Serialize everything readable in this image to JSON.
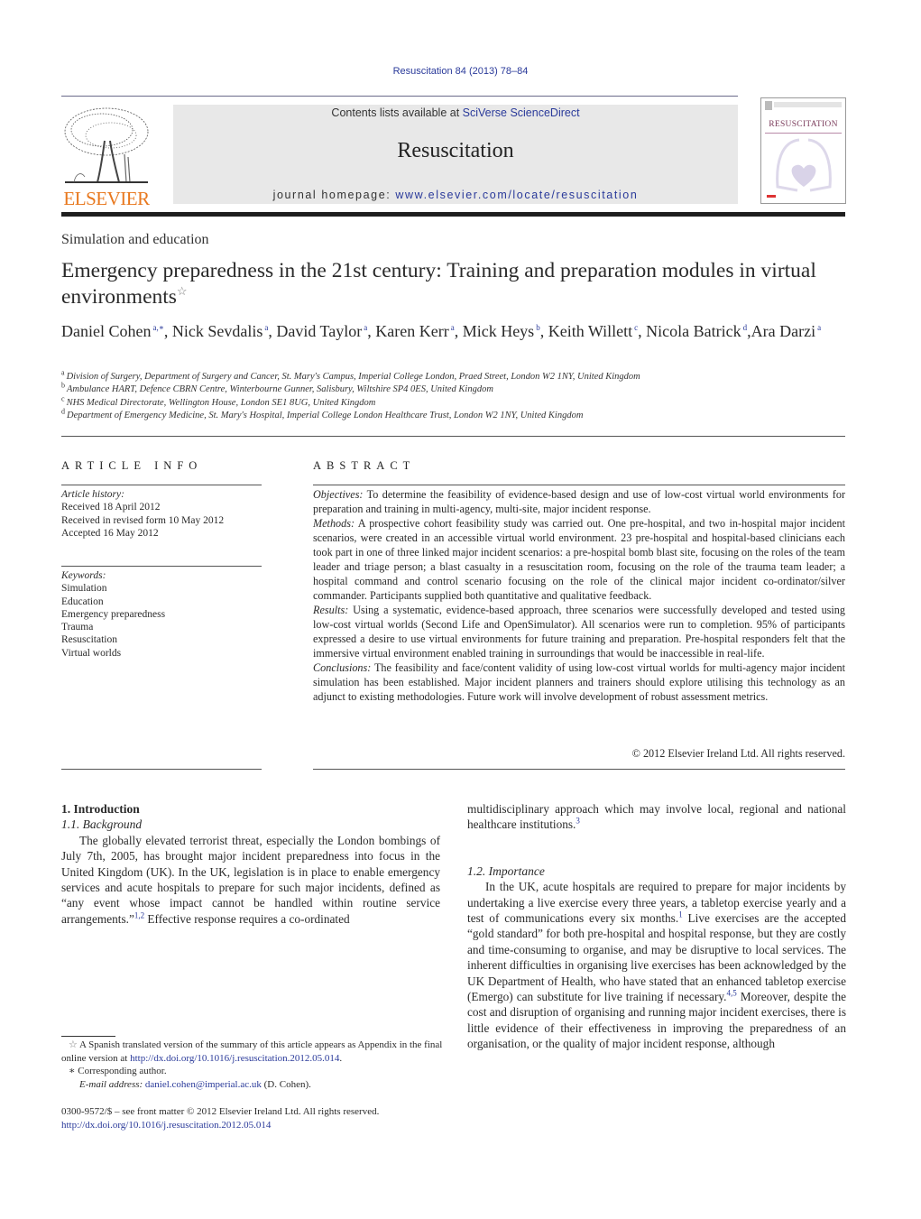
{
  "journal_ref": "Resuscitation 84 (2013) 78–84",
  "header": {
    "publisher": "ELSEVIER",
    "contents_prefix": "Contents lists available at ",
    "contents_link": "SciVerse ScienceDirect",
    "journal_title": "Resuscitation",
    "homepage_prefix": "journal homepage: ",
    "homepage_url": "www.elsevier.com/locate/resuscitation",
    "cover_title": "RESUSCITATION",
    "colors": {
      "link": "#2a3a9a",
      "publisher_orange": "#e8781e",
      "band": "#e8e8e8"
    }
  },
  "article": {
    "section": "Simulation and education",
    "title": "Emergency preparedness in the 21st century: Training and preparation modules in virtual environments",
    "title_mark": "☆",
    "authors": [
      {
        "name": "Daniel Cohen",
        "sup": "a,∗",
        "sep": ", "
      },
      {
        "name": "Nick Sevdalis",
        "sup": "a",
        "sep": ", "
      },
      {
        "name": "David Taylor",
        "sup": "a",
        "sep": ", "
      },
      {
        "name": "Karen Kerr",
        "sup": "a",
        "sep": ", "
      },
      {
        "name": "Mick Heys",
        "sup": "b",
        "sep": ", "
      },
      {
        "name": "Keith Willett",
        "sup": "c",
        "sep": ", "
      },
      {
        "name": "Nicola Batrick",
        "sup": "d",
        "sep": ","
      },
      {
        "name": "Ara Darzi",
        "sup": "a",
        "sep": ""
      }
    ],
    "affiliations": [
      {
        "key": "a",
        "text": "Division of Surgery, Department of Surgery and Cancer, St. Mary's Campus, Imperial College London, Praed Street, London W2 1NY, United Kingdom"
      },
      {
        "key": "b",
        "text": "Ambulance HART, Defence CBRN Centre, Winterbourne Gunner, Salisbury, Wiltshire SP4 0ES, United Kingdom"
      },
      {
        "key": "c",
        "text": "NHS Medical Directorate, Wellington House, London SE1 8UG, United Kingdom"
      },
      {
        "key": "d",
        "text": "Department of Emergency Medicine, St. Mary's Hospital, Imperial College London Healthcare Trust, London W2 1NY, United Kingdom"
      }
    ]
  },
  "article_info": {
    "heading": "ARTICLE INFO",
    "history_label": "Article history:",
    "history": [
      "Received 18 April 2012",
      "Received in revised form 10 May 2012",
      "Accepted 16 May 2012"
    ],
    "keywords_label": "Keywords:",
    "keywords": [
      "Simulation",
      "Education",
      "Emergency preparedness",
      "Trauma",
      "Resuscitation",
      "Virtual worlds"
    ]
  },
  "abstract": {
    "heading": "ABSTRACT",
    "sections": [
      {
        "label": "Objectives:",
        "text": " To determine the feasibility of evidence-based design and use of low-cost virtual world environments for preparation and training in multi-agency, multi-site, major incident response."
      },
      {
        "label": "Methods:",
        "text": " A prospective cohort feasibility study was carried out. One pre-hospital, and two in-hospital major incident scenarios, were created in an accessible virtual world environment. 23 pre-hospital and hospital-based clinicians each took part in one of three linked major incident scenarios: a pre-hospital bomb blast site, focusing on the roles of the team leader and triage person; a blast casualty in a resuscitation room, focusing on the role of the trauma team leader; a hospital command and control scenario focusing on the role of the clinical major incident co-ordinator/silver commander. Participants supplied both quantitative and qualitative feedback."
      },
      {
        "label": "Results:",
        "text": " Using a systematic, evidence-based approach, three scenarios were successfully developed and tested using low-cost virtual worlds (Second Life and OpenSimulator). All scenarios were run to completion. 95% of participants expressed a desire to use virtual environments for future training and preparation. Pre-hospital responders felt that the immersive virtual environment enabled training in surroundings that would be inaccessible in real-life."
      },
      {
        "label": "Conclusions:",
        "text": " The feasibility and face/content validity of using low-cost virtual worlds for multi-agency major incident simulation has been established. Major incident planners and trainers should explore utilising this technology as an adjunct to existing methodologies. Future work will involve development of robust assessment metrics."
      }
    ],
    "copyright": "© 2012 Elsevier Ireland Ltd. All rights reserved."
  },
  "body": {
    "section_1": "1.  Introduction",
    "subsection_1_1": "1.1.  Background",
    "para_1_1": {
      "before": "The globally elevated terrorist threat, especially the London bombings of July 7th, 2005, has brought major incident preparedness into focus in the United Kingdom (UK). In the UK, legislation is in place to enable emergency services and acute hospitals to prepare for such major incidents, defined as “any event whose impact cannot be handled within routine service arrangements.”",
      "ref": "1,2",
      "after": " Effective response requires a co-ordinated"
    },
    "para_1_1_cont": {
      "before": "multidisciplinary approach which may involve local, regional and national healthcare institutions.",
      "ref": "3"
    },
    "subsection_1_2": "1.2.  Importance",
    "para_1_2": {
      "part1": "In the UK, acute hospitals are required to prepare for major incidents by undertaking a live exercise every three years, a tabletop exercise yearly and a test of communications every six months.",
      "ref1": "1",
      "part2": " Live exercises are the accepted “gold standard” for both pre-hospital and hospital response, but they are costly and time-consuming to organise, and may be disruptive to local services. The inherent difficulties in organising live exercises has been acknowledged by the UK Department of Health, who have stated that an enhanced tabletop exercise (Emergo) can substitute for live training if necessary.",
      "ref2": "4,5",
      "part3": " Moreover, despite the cost and disruption of organising and running major incident exercises, there is little evidence of their effectiveness in improving the preparedness of an organisation, or the quality of major incident response, although"
    }
  },
  "footnotes": {
    "star_mark": "☆",
    "star_text": " A Spanish translated version of the summary of this article appears as Appendix in the final online version at ",
    "star_link": "http://dx.doi.org/10.1016/j.resuscitation.2012.05.014",
    "star_end": ".",
    "corr_mark": "∗",
    "corr_text": " Corresponding author.",
    "email_label": "E-mail address:",
    "email": "daniel.cohen@imperial.ac.uk",
    "email_suffix": " (D. Cohen).",
    "front_matter": "0300-9572/$ – see front matter © 2012 Elsevier Ireland Ltd. All rights reserved.",
    "doi": "http://dx.doi.org/10.1016/j.resuscitation.2012.05.014"
  }
}
